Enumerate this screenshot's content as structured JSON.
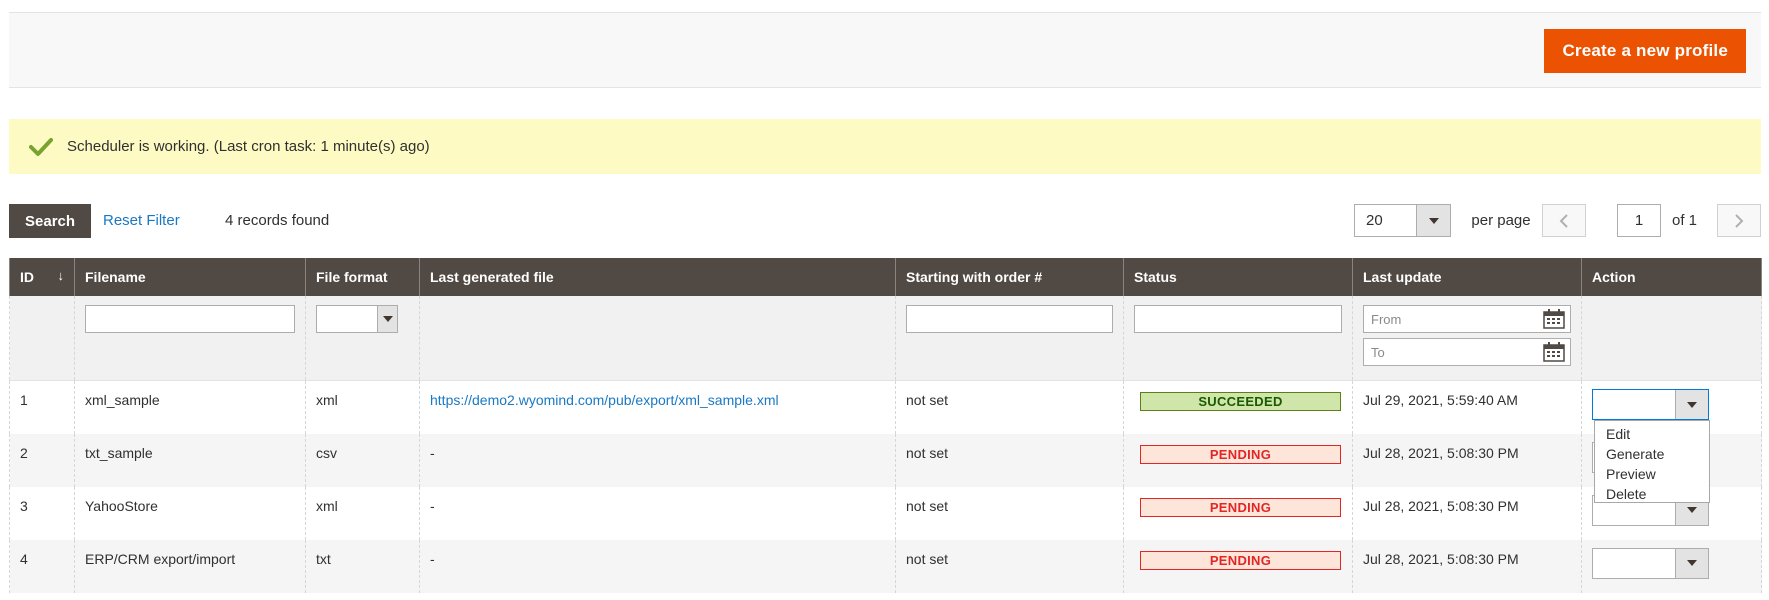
{
  "header": {
    "create_button": "Create a new profile",
    "create_button_color": "#eb5202"
  },
  "message": {
    "icon": "check-icon",
    "text": "Scheduler is working. (Last cron task: 1 minute(s) ago)"
  },
  "toolbar": {
    "search_label": "Search",
    "reset_label": "Reset Filter",
    "records_found": "4 records found",
    "per_page_value": "20",
    "per_page_label": "per page",
    "page_current": "1",
    "page_of": "of 1"
  },
  "grid": {
    "columns": [
      "ID",
      "Filename",
      "File format",
      "Last generated file",
      "Starting with order #",
      "Status",
      "Last update",
      "Action"
    ],
    "filters": {
      "date_from_placeholder": "From",
      "date_to_placeholder": "To"
    },
    "rows": [
      {
        "id": "1",
        "filename": "xml_sample",
        "format": "xml",
        "last_file": "https://demo2.wyomind.com/pub/export/xml_sample.xml",
        "start_order": "not set",
        "status": "SUCCEEDED",
        "last_update": "Jul 29, 2021, 5:59:40 AM"
      },
      {
        "id": "2",
        "filename": "txt_sample",
        "format": "csv",
        "last_file": "-",
        "start_order": "not set",
        "status": "PENDING",
        "last_update": "Jul 28, 2021, 5:08:30 PM"
      },
      {
        "id": "3",
        "filename": "YahooStore",
        "format": "xml",
        "last_file": "-",
        "start_order": "not set",
        "status": "PENDING",
        "last_update": "Jul 28, 2021, 5:08:30 PM"
      },
      {
        "id": "4",
        "filename": "ERP/CRM export/import",
        "format": "txt",
        "last_file": "-",
        "start_order": "not set",
        "status": "PENDING",
        "last_update": "Jul 28, 2021, 5:08:30 PM"
      }
    ],
    "action_options": [
      "Edit",
      "Generate",
      "Preview",
      "Delete"
    ]
  }
}
